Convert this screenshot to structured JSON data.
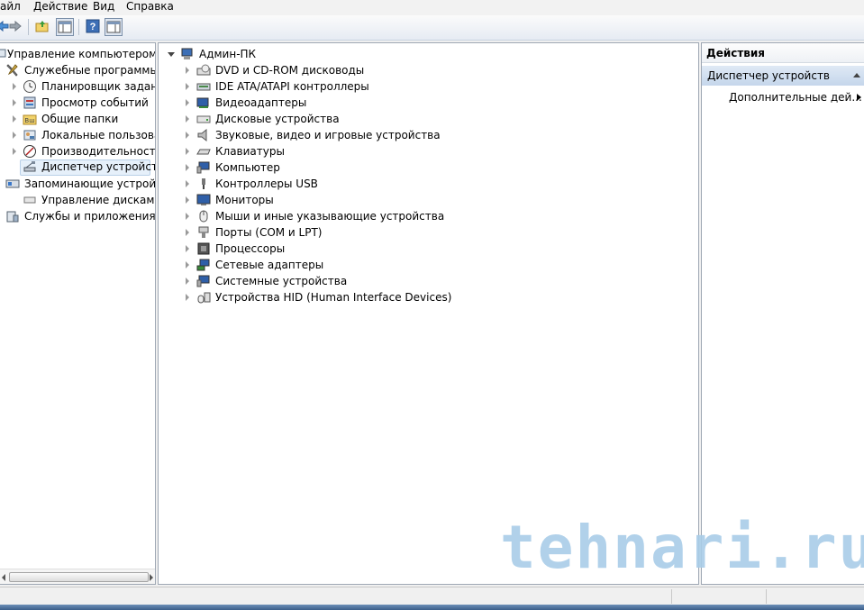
{
  "menu": {
    "items": [
      "айл",
      "Действие",
      "Вид",
      "Справка"
    ]
  },
  "left_tree": {
    "root": "Управление компьютером (л",
    "items": [
      {
        "label": "Служебные программы",
        "icon": "tools-icon"
      },
      {
        "label": "Планировщик заданий",
        "icon": "clock-icon"
      },
      {
        "label": "Просмотр событий",
        "icon": "event-viewer-icon"
      },
      {
        "label": "Общие папки",
        "icon": "shared-folder-icon"
      },
      {
        "label": "Локальные пользовате",
        "icon": "users-icon"
      },
      {
        "label": "Производительность",
        "icon": "performance-icon"
      },
      {
        "label": "Диспетчер устройств",
        "icon": "device-manager-icon"
      },
      {
        "label": "Запоминающие устройст",
        "icon": "storage-icon"
      },
      {
        "label": "Управление дисками",
        "icon": "disk-management-icon"
      },
      {
        "label": "Службы и приложения",
        "icon": "services-icon"
      }
    ]
  },
  "device_tree": {
    "root": "Админ-ПК",
    "categories": [
      "DVD и CD-ROM дисководы",
      "IDE ATA/ATAPI контроллеры",
      "Видеоадаптеры",
      "Дисковые устройства",
      "Звуковые, видео и игровые устройства",
      "Клавиатуры",
      "Компьютер",
      "Контроллеры USB",
      "Мониторы",
      "Мыши и иные указывающие устройства",
      "Порты (COM и LPT)",
      "Процессоры",
      "Сетевые адаптеры",
      "Системные устройства",
      "Устройства HID (Human Interface Devices)"
    ]
  },
  "actions": {
    "header": "Действия",
    "section": "Диспетчер устройств",
    "item": "Дополнительные дей..."
  },
  "watermark": "tehnari.ru"
}
